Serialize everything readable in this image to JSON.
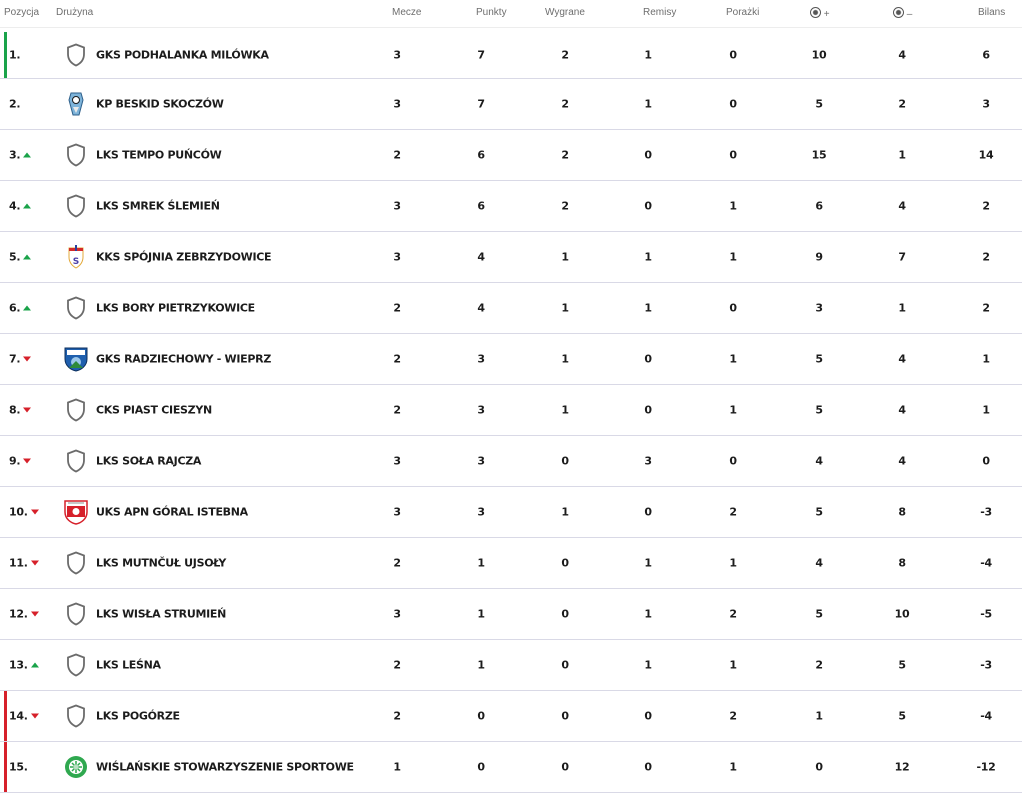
{
  "header": {
    "pozycja": "Pozycja",
    "druzyna": "Drużyna",
    "mecze": "Mecze",
    "punkty": "Punkty",
    "wygrane": "Wygrane",
    "remisy": "Remisy",
    "porazki": "Porażki",
    "goals_for_sign": "+",
    "goals_against_sign": "–",
    "bilans": "Bilans"
  },
  "colors": {
    "promotion": "#1aa34a",
    "relegation": "#d6202a"
  },
  "rows": [
    {
      "pos": "1.",
      "trend": "",
      "zone": "promotion",
      "crest": "shield-icon",
      "team": "GKS Podhalanka Milówka",
      "m": "3",
      "p": "7",
      "w": "2",
      "r": "1",
      "l": "0",
      "gf": "10",
      "ga": "4",
      "b": "6"
    },
    {
      "pos": "2.",
      "trend": "",
      "zone": "",
      "crest": "beskid-crest",
      "team": "KP Beskid Skoczów",
      "m": "3",
      "p": "7",
      "w": "2",
      "r": "1",
      "l": "0",
      "gf": "5",
      "ga": "2",
      "b": "3"
    },
    {
      "pos": "3.",
      "trend": "up",
      "zone": "",
      "crest": "shield-icon",
      "team": "LKS Tempo Puńców",
      "m": "2",
      "p": "6",
      "w": "2",
      "r": "0",
      "l": "0",
      "gf": "15",
      "ga": "1",
      "b": "14"
    },
    {
      "pos": "4.",
      "trend": "up",
      "zone": "",
      "crest": "shield-icon",
      "team": "LKS Smrek Ślemień",
      "m": "3",
      "p": "6",
      "w": "2",
      "r": "0",
      "l": "1",
      "gf": "6",
      "ga": "4",
      "b": "2"
    },
    {
      "pos": "5.",
      "trend": "up",
      "zone": "",
      "crest": "spojnia-crest",
      "team": "KKS Spójnia Zebrzydowice",
      "m": "3",
      "p": "4",
      "w": "1",
      "r": "1",
      "l": "1",
      "gf": "9",
      "ga": "7",
      "b": "2"
    },
    {
      "pos": "6.",
      "trend": "up",
      "zone": "",
      "crest": "shield-icon",
      "team": "LKS Bory Pietrzykowice",
      "m": "2",
      "p": "4",
      "w": "1",
      "r": "1",
      "l": "0",
      "gf": "3",
      "ga": "1",
      "b": "2"
    },
    {
      "pos": "7.",
      "trend": "down",
      "zone": "",
      "crest": "radziechowy-crest",
      "team": "GKS Radziechowy - Wieprz",
      "m": "2",
      "p": "3",
      "w": "1",
      "r": "0",
      "l": "1",
      "gf": "5",
      "ga": "4",
      "b": "1"
    },
    {
      "pos": "8.",
      "trend": "down",
      "zone": "",
      "crest": "shield-icon",
      "team": "CKS Piast Cieszyn",
      "m": "2",
      "p": "3",
      "w": "1",
      "r": "0",
      "l": "1",
      "gf": "5",
      "ga": "4",
      "b": "1"
    },
    {
      "pos": "9.",
      "trend": "down",
      "zone": "",
      "crest": "shield-icon",
      "team": "LKS Soła Rajcza",
      "m": "3",
      "p": "3",
      "w": "0",
      "r": "3",
      "l": "0",
      "gf": "4",
      "ga": "4",
      "b": "0"
    },
    {
      "pos": "10.",
      "trend": "down",
      "zone": "",
      "crest": "goral-crest",
      "team": "UKS APN Góral Istebna",
      "m": "3",
      "p": "3",
      "w": "1",
      "r": "0",
      "l": "2",
      "gf": "5",
      "ga": "8",
      "b": "-3"
    },
    {
      "pos": "11.",
      "trend": "down",
      "zone": "",
      "crest": "shield-icon",
      "team": "LKS Mutnčuł Ujsoły",
      "m": "2",
      "p": "1",
      "w": "0",
      "r": "1",
      "l": "1",
      "gf": "4",
      "ga": "8",
      "b": "-4"
    },
    {
      "pos": "12.",
      "trend": "down",
      "zone": "",
      "crest": "shield-icon",
      "team": "LKS Wisła Strumień",
      "m": "3",
      "p": "1",
      "w": "0",
      "r": "1",
      "l": "2",
      "gf": "5",
      "ga": "10",
      "b": "-5"
    },
    {
      "pos": "13.",
      "trend": "up",
      "zone": "",
      "crest": "shield-icon",
      "team": "LKS Leśna",
      "m": "2",
      "p": "1",
      "w": "0",
      "r": "1",
      "l": "1",
      "gf": "2",
      "ga": "5",
      "b": "-3"
    },
    {
      "pos": "14.",
      "trend": "down",
      "zone": "relegation",
      "crest": "shield-icon",
      "team": "LKS Pogórze",
      "m": "2",
      "p": "0",
      "w": "0",
      "r": "0",
      "l": "2",
      "gf": "1",
      "ga": "5",
      "b": "-4"
    },
    {
      "pos": "15.",
      "trend": "",
      "zone": "relegation",
      "crest": "wss-crest",
      "team": "Wiślańskie Stowarzyszenie Sportowe",
      "m": "1",
      "p": "0",
      "w": "0",
      "r": "0",
      "l": "1",
      "gf": "0",
      "ga": "12",
      "b": "-12"
    }
  ]
}
